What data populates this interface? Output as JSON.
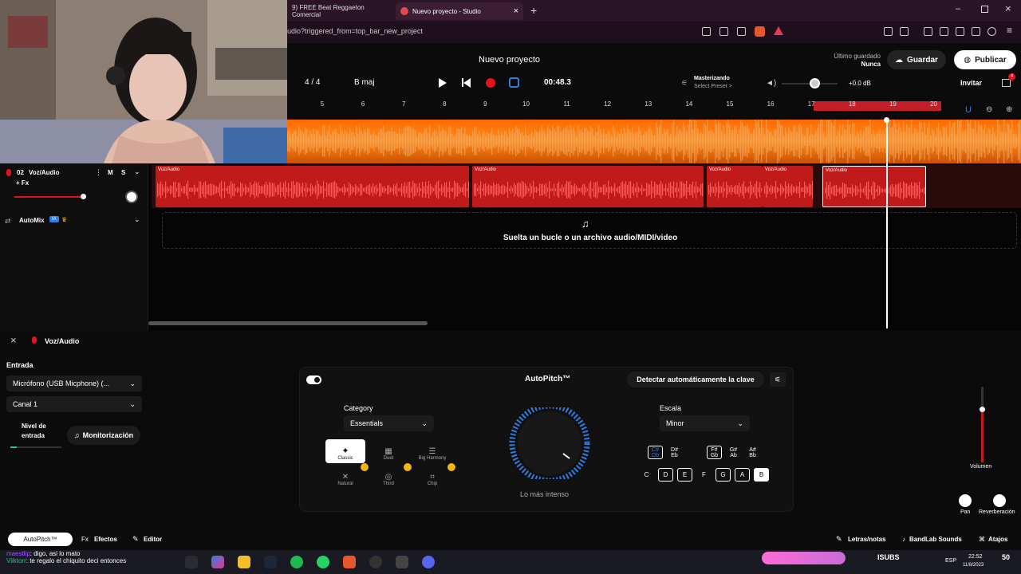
{
  "browser": {
    "tabs": [
      {
        "label": "9) FREE Beat Reggaeton Comercial"
      },
      {
        "label": "Nuevo proyecto - Studio"
      }
    ],
    "url": "udio?triggered_from=top_bar_new_project"
  },
  "header": {
    "title": "Nuevo proyecto",
    "last_saved_label": "Último guardado",
    "last_saved_value": "Nunca",
    "save_label": "Guardar",
    "publish_label": "Publicar",
    "invite_label": "Invitar",
    "notif_count": "4"
  },
  "transport": {
    "time_signature": "4 / 4",
    "key": "B maj",
    "time": "00:48.3",
    "master_label": "Masterizando",
    "master_preset": "Select Preset >",
    "master_db": "+0.0 dB"
  },
  "ruler": {
    "ticks": [
      "5",
      "6",
      "7",
      "8",
      "9",
      "10",
      "11",
      "12",
      "13",
      "14",
      "15",
      "16",
      "17",
      "18",
      "19",
      "20"
    ]
  },
  "tracks": [
    {
      "number": "02",
      "name": "Voz/Audio",
      "fx": "+ Fx",
      "mute": "M",
      "solo": "S"
    }
  ],
  "automix": {
    "label": "AutoMix",
    "badge": "IA"
  },
  "clips": [
    "Voz/Audio",
    "Voz/Audio",
    "Voz/Audio",
    "Voz/Audio",
    "Voz/Audio"
  ],
  "dropzone": {
    "text": "Suelta un bucle o un archivo audio/MIDI/video"
  },
  "panel": {
    "track_name": "Voz/Audio",
    "input_label": "Entrada",
    "input_device": "Micrófono (USB Micphone) (...",
    "channel": "Canal 1",
    "input_level_label": "Nivel de entrada",
    "monitor_label": "Monitorización"
  },
  "autopitch": {
    "title": "AutoPitch™",
    "detect_key_label": "Detectar automáticamente la clave",
    "category_label": "Category",
    "category_value": "Essentials",
    "presets": [
      {
        "name": "Classic"
      },
      {
        "name": "Duet"
      },
      {
        "name": "Big Harmony"
      },
      {
        "name": "Natural"
      },
      {
        "name": "Third"
      },
      {
        "name": "Chip"
      }
    ],
    "knob_label": "Lo más intenso",
    "scale_label": "Escala",
    "scale_value": "Minor",
    "sharp_keys": [
      "C#\nDb",
      "D#\nEb",
      "F#\nGb",
      "G#\nAb",
      "A#\nBb"
    ],
    "natural_keys": [
      "C",
      "D",
      "E",
      "F",
      "G",
      "A",
      "B"
    ]
  },
  "mixer": {
    "volume_label": "Volumen",
    "pan_label": "Pan",
    "reverb_label": "Reverberación"
  },
  "bottom_tabs": {
    "autopitch": "AutoPitch™",
    "effects": "Efectos",
    "editor": "Editor"
  },
  "bottom_right": {
    "lyrics": "Letras/notas",
    "sounds": "BandLab Sounds",
    "shortcuts": "Atajos"
  },
  "chat": [
    {
      "user": "maestlip",
      "text": "digo, asi lo mato"
    },
    {
      "user": "Viiktorr",
      "text": "te regalo el chiquito deci entonces"
    }
  ],
  "taskbar": {
    "time": "22:52",
    "date": "11/8/2023",
    "lang": "ESP",
    "widget": "ISUBS",
    "count": "50"
  },
  "colors": {
    "accent_red": "#c01a1a",
    "waveform_orange": "#ff7a00",
    "loop_red": "#c41e2a",
    "knob_blue": "#2f7de1"
  }
}
